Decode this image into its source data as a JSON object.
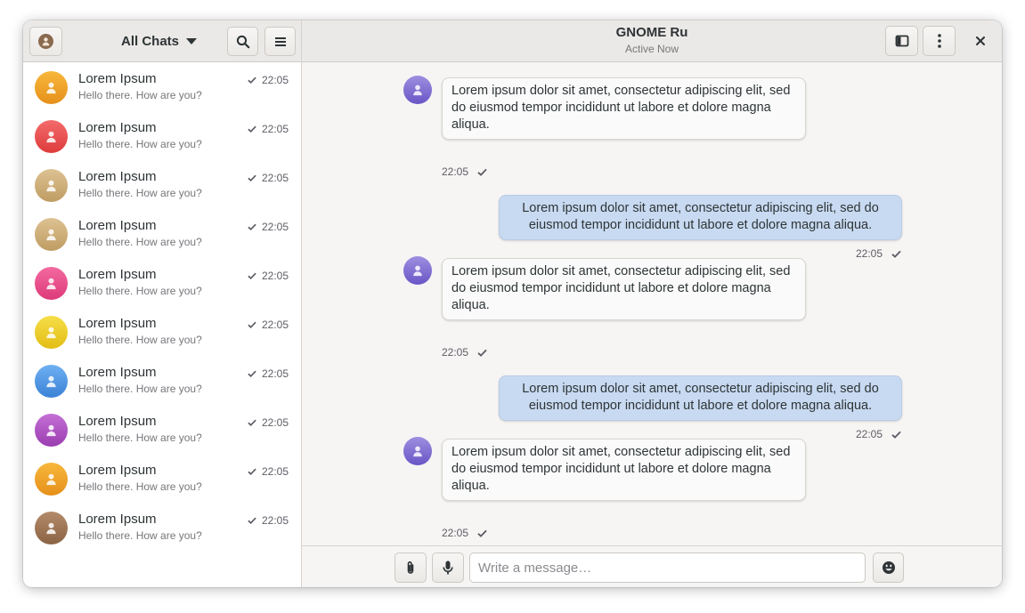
{
  "sidebar": {
    "filter_label": "All Chats",
    "chats": [
      {
        "name": "Lorem Ipsum",
        "preview": "Hello there. How are you?",
        "time": "22:05",
        "color_top": "#f8b73c",
        "color_bottom": "#e5901a"
      },
      {
        "name": "Lorem Ipsum",
        "preview": "Hello there. How are you?",
        "time": "22:05",
        "color_top": "#f46b6b",
        "color_bottom": "#de3b3b"
      },
      {
        "name": "Lorem Ipsum",
        "preview": "Hello there. How are you?",
        "time": "22:05",
        "color_top": "#ddc292",
        "color_bottom": "#bf9c62"
      },
      {
        "name": "Lorem Ipsum",
        "preview": "Hello there. How are you?",
        "time": "22:05",
        "color_top": "#ddc292",
        "color_bottom": "#bf9c62"
      },
      {
        "name": "Lorem Ipsum",
        "preview": "Hello there. How are you?",
        "time": "22:05",
        "color_top": "#f36aa0",
        "color_bottom": "#dd3a79"
      },
      {
        "name": "Lorem Ipsum",
        "preview": "Hello there. How are you?",
        "time": "22:05",
        "color_top": "#f6de49",
        "color_bottom": "#e3bd14"
      },
      {
        "name": "Lorem Ipsum",
        "preview": "Hello there. How are you?",
        "time": "22:05",
        "color_top": "#6fb0f2",
        "color_bottom": "#3b82d6"
      },
      {
        "name": "Lorem Ipsum",
        "preview": "Hello there. How are you?",
        "time": "22:05",
        "color_top": "#c46fd6",
        "color_bottom": "#9b3db1"
      },
      {
        "name": "Lorem Ipsum",
        "preview": "Hello there. How are you?",
        "time": "22:05",
        "color_top": "#f8b73c",
        "color_bottom": "#e5901a"
      },
      {
        "name": "Lorem Ipsum",
        "preview": "Hello there. How are you?",
        "time": "22:05",
        "color_top": "#b48b6a",
        "color_bottom": "#8a6345"
      }
    ]
  },
  "header": {
    "title": "GNOME Ru",
    "subtitle": "Active Now"
  },
  "conversation": {
    "messages": [
      {
        "direction": "incoming",
        "text": "Lorem ipsum dolor sit amet, consectetur adipiscing elit, sed do eiusmod tempor incididunt ut labore et dolore magna aliqua.",
        "time": "22:05"
      },
      {
        "direction": "outgoing",
        "text": "Lorem ipsum dolor sit amet, consectetur adipiscing elit, sed do eiusmod tempor incididunt ut labore et dolore magna aliqua.",
        "time": "22:05"
      },
      {
        "direction": "incoming",
        "text": "Lorem ipsum dolor sit amet, consectetur adipiscing elit, sed do eiusmod tempor incididunt ut labore et dolore magna aliqua.",
        "time": "22:05"
      },
      {
        "direction": "outgoing",
        "text": "Lorem ipsum dolor sit amet, consectetur adipiscing elit, sed do eiusmod tempor incididunt ut labore et dolore magna aliqua.",
        "time": "22:05"
      },
      {
        "direction": "incoming",
        "text": "Lorem ipsum dolor sit amet, consectetur adipiscing elit, sed do eiusmod tempor incididunt ut labore et dolore magna aliqua.",
        "time": "22:05"
      },
      {
        "direction": "outgoing",
        "text": "",
        "time": ""
      }
    ]
  },
  "composer": {
    "placeholder": "Write a message…"
  },
  "colors": {
    "outgoing_bubble": "#c8daf1",
    "incoming_bubble": "#fafafa",
    "incoming_avatar": "#7b66d1",
    "account_avatar": "#8a6a4e",
    "header_bg": "#ebe9e7"
  },
  "icons": {
    "account": "avatar-icon",
    "search": "search-icon",
    "menu": "hamburger-menu-icon",
    "sidebar_toggle": "sidebar-toggle-icon",
    "more": "more-vertical-icon",
    "close": "close-icon",
    "attach": "paperclip-icon",
    "microphone": "microphone-icon",
    "emoji": "emoji-icon",
    "read_receipt": "check-icon"
  }
}
